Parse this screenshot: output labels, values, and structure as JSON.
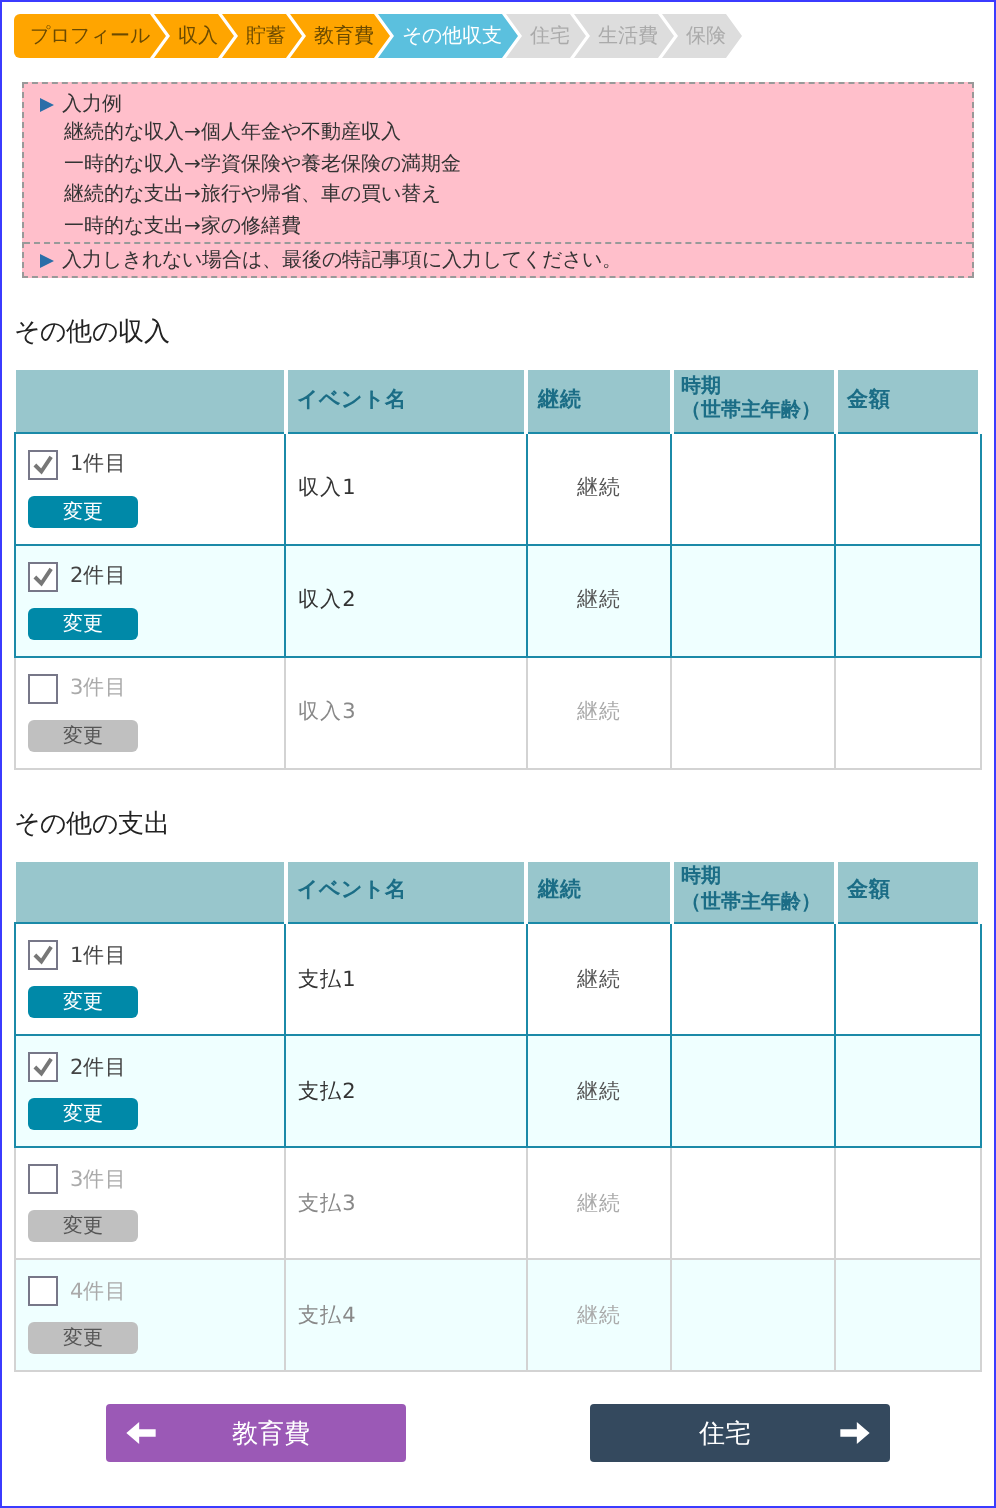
{
  "steps": [
    {
      "label": "プロフィール",
      "completed": true,
      "selected": false
    },
    {
      "label": "収入",
      "completed": true,
      "selected": false
    },
    {
      "label": "貯蓄",
      "completed": true,
      "selected": false
    },
    {
      "label": "教育費",
      "completed": true,
      "selected": false
    },
    {
      "label": "その他収支",
      "completed": false,
      "selected": true
    },
    {
      "label": "住宅",
      "completed": false,
      "selected": false
    },
    {
      "label": "生活費",
      "completed": false,
      "selected": false
    },
    {
      "label": "保険",
      "completed": false,
      "selected": false
    }
  ],
  "notice": {
    "heading": "入力例",
    "lines": [
      "継続的な収入→個人年金や不動産収入",
      "一時的な収入→学資保険や養老保険の満期金",
      "継続的な支出→旅行や帰省、車の買い替え",
      "一時的な支出→家の修繕費"
    ],
    "footer": "入力しきれない場合は、最後の特記事項に入力してください。"
  },
  "sections": [
    {
      "title": "その他の収入",
      "columns": [
        "イベント名",
        "継続",
        "時期（世帯主年齢）",
        "金額"
      ],
      "rows": [
        {
          "item": "1件目",
          "checked": true,
          "button": "変更",
          "name": "収入1",
          "continuation": "継続"
        },
        {
          "item": "2件目",
          "checked": true,
          "button": "変更",
          "name": "収入2",
          "continuation": "継続"
        },
        {
          "item": "3件目",
          "checked": false,
          "button": "変更",
          "name": "収入3",
          "continuation": "継続"
        }
      ]
    },
    {
      "title": "その他の支出",
      "columns": [
        "イベント名",
        "継続",
        "時期（世帯主年齢）",
        "金額"
      ],
      "rows": [
        {
          "item": "1件目",
          "checked": true,
          "button": "変更",
          "name": "支払1",
          "continuation": "継続"
        },
        {
          "item": "2件目",
          "checked": true,
          "button": "変更",
          "name": "支払2",
          "continuation": "継続"
        },
        {
          "item": "3件目",
          "checked": false,
          "button": "変更",
          "name": "支払3",
          "continuation": "継続"
        },
        {
          "item": "4件目",
          "checked": false,
          "button": "変更",
          "name": "支払4",
          "continuation": "継続"
        }
      ]
    }
  ],
  "nav": {
    "back": "教育費",
    "next": "住宅"
  }
}
